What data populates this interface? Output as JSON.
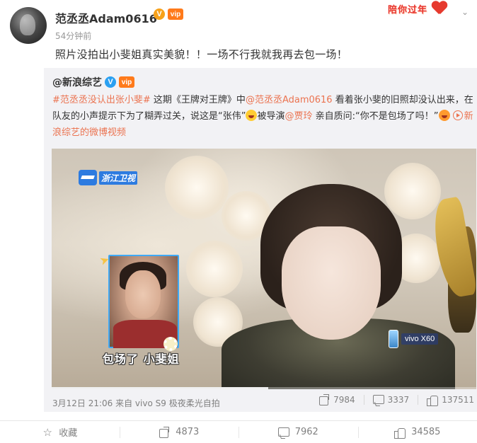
{
  "post": {
    "username": "范丞丞Adam0616",
    "time_ago": "54分钟前",
    "text": "照片没拍出小斐姐真实美貌！！一场不行我就我再去包一场！",
    "promo_text": "陪你过年",
    "badge_v": "V",
    "badge_vip": "vip"
  },
  "repost": {
    "author": "@新浪综艺",
    "badge_v": "V",
    "text_hashtag": "#范丞丞没认出张小斐#",
    "text_part1": " 这期《王牌对王牌》中",
    "text_mention1": "@范丞丞Adam0616",
    "text_part2": " 看着张小斐的旧照却没认出来，在队友的小声提示下为了糊弄过关，说这是“张伟”",
    "text_part3": "被导演",
    "text_mention2": "@贾玲",
    "text_part4": " 亲自质问:“你不是包场了吗！”",
    "video_link": "新浪综艺的微博视频",
    "meta": "3月12日 21:06 来自 vivo S9 极夜柔光自拍",
    "shares": "7984",
    "comments": "3337",
    "likes": "137511"
  },
  "video": {
    "channel_logo": "浙江卫视",
    "caption": "包场了 小斐姐",
    "sponsor": "vivo X60",
    "progress": 0.51
  },
  "actions": {
    "favorite_label": "收藏",
    "share_count": "4873",
    "comment_count": "7962",
    "like_count": "34585"
  },
  "colors": {
    "link": "#eb7350",
    "promo": "#e8342f",
    "badge_orange": "#f7a11a",
    "badge_blue": "#2aa0f1"
  },
  "icons": [
    "chevron-down-icon",
    "heart-icon",
    "star-icon",
    "share-icon",
    "comment-icon",
    "like-icon",
    "play-link-icon"
  ]
}
